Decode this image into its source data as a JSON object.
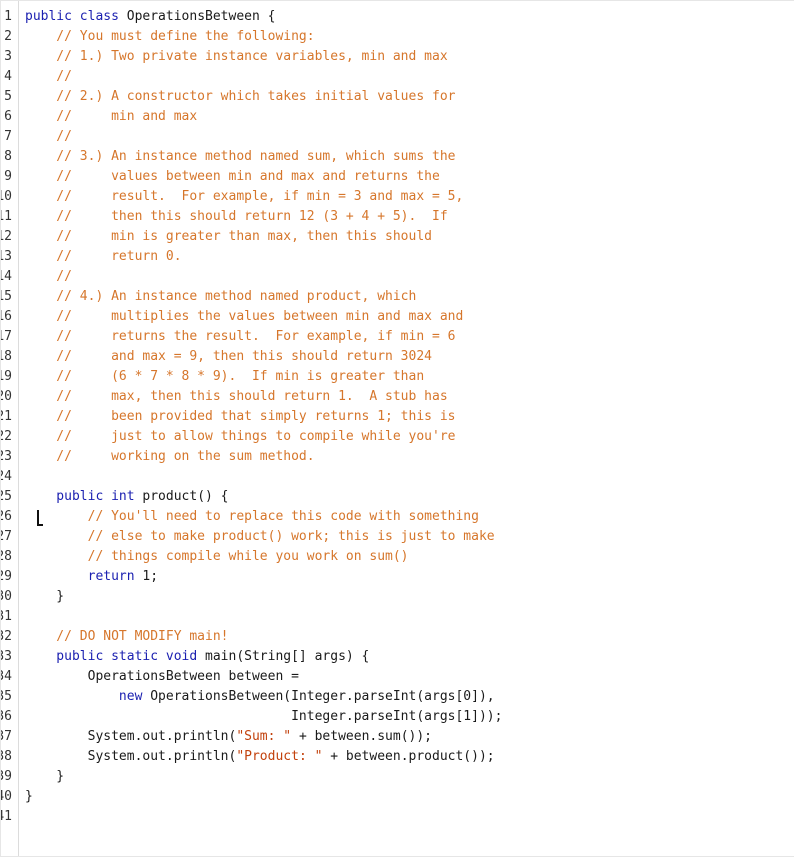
{
  "editor": {
    "language": "Java",
    "lines": [
      {
        "n": "1",
        "segments": [
          {
            "t": "public class ",
            "c": "kw"
          },
          {
            "t": "OperationsBetween {",
            "c": "pl"
          }
        ]
      },
      {
        "n": "2",
        "segments": [
          {
            "t": "    // You must define the following:",
            "c": "cm"
          }
        ]
      },
      {
        "n": "3",
        "segments": [
          {
            "t": "    // 1.) Two private instance variables, min and max",
            "c": "cm"
          }
        ]
      },
      {
        "n": "4",
        "segments": [
          {
            "t": "    //",
            "c": "cm"
          }
        ]
      },
      {
        "n": "5",
        "segments": [
          {
            "t": "    // 2.) A constructor which takes initial values for",
            "c": "cm"
          }
        ]
      },
      {
        "n": "6",
        "segments": [
          {
            "t": "    //     min and max",
            "c": "cm"
          }
        ]
      },
      {
        "n": "7",
        "segments": [
          {
            "t": "    //",
            "c": "cm"
          }
        ]
      },
      {
        "n": "8",
        "segments": [
          {
            "t": "    // 3.) An instance method named sum, which sums the",
            "c": "cm"
          }
        ]
      },
      {
        "n": "9",
        "segments": [
          {
            "t": "    //     values between min and max and returns the",
            "c": "cm"
          }
        ]
      },
      {
        "n": "10",
        "segments": [
          {
            "t": "    //     result.  For example, if min = 3 and max = 5,",
            "c": "cm"
          }
        ]
      },
      {
        "n": "11",
        "segments": [
          {
            "t": "    //     then this should return 12 (3 + 4 + 5).  If",
            "c": "cm"
          }
        ]
      },
      {
        "n": "12",
        "segments": [
          {
            "t": "    //     min is greater than max, then this should",
            "c": "cm"
          }
        ]
      },
      {
        "n": "13",
        "segments": [
          {
            "t": "    //     return 0.",
            "c": "cm"
          }
        ]
      },
      {
        "n": "14",
        "segments": [
          {
            "t": "    //",
            "c": "cm"
          }
        ]
      },
      {
        "n": "15",
        "segments": [
          {
            "t": "    // 4.) An instance method named product, which",
            "c": "cm"
          }
        ]
      },
      {
        "n": "16",
        "segments": [
          {
            "t": "    //     multiplies the values between min and max and",
            "c": "cm"
          }
        ]
      },
      {
        "n": "17",
        "segments": [
          {
            "t": "    //     returns the result.  For example, if min = 6",
            "c": "cm"
          }
        ]
      },
      {
        "n": "18",
        "segments": [
          {
            "t": "    //     and max = 9, then this should return 3024",
            "c": "cm"
          }
        ]
      },
      {
        "n": "19",
        "segments": [
          {
            "t": "    //     (6 * 7 * 8 * 9).  If min is greater than",
            "c": "cm"
          }
        ]
      },
      {
        "n": "20",
        "segments": [
          {
            "t": "    //     max, then this should return 1.  A stub has",
            "c": "cm"
          }
        ]
      },
      {
        "n": "21",
        "segments": [
          {
            "t": "    //     been provided that simply returns 1; this is",
            "c": "cm"
          }
        ]
      },
      {
        "n": "22",
        "segments": [
          {
            "t": "    //     just to allow things to compile while you're",
            "c": "cm"
          }
        ]
      },
      {
        "n": "23",
        "segments": [
          {
            "t": "    //     working on the sum method.",
            "c": "cm"
          }
        ]
      },
      {
        "n": "24",
        "segments": []
      },
      {
        "n": "25",
        "segments": [
          {
            "t": "    public int ",
            "c": "kw"
          },
          {
            "t": "product() {",
            "c": "pl"
          }
        ]
      },
      {
        "n": "26",
        "segments": [
          {
            "t": "        // You'll need to replace this code with something",
            "c": "cm"
          }
        ]
      },
      {
        "n": "27",
        "segments": [
          {
            "t": "        // else to make product() work; this is just to make",
            "c": "cm"
          }
        ]
      },
      {
        "n": "28",
        "segments": [
          {
            "t": "        // things compile while you work on sum()",
            "c": "cm"
          }
        ]
      },
      {
        "n": "29",
        "segments": [
          {
            "t": "        return ",
            "c": "kw"
          },
          {
            "t": "1;",
            "c": "pl"
          }
        ]
      },
      {
        "n": "30",
        "segments": [
          {
            "t": "    }",
            "c": "pl"
          }
        ]
      },
      {
        "n": "31",
        "segments": []
      },
      {
        "n": "32",
        "segments": [
          {
            "t": "    // DO NOT MODIFY main!",
            "c": "cm"
          }
        ]
      },
      {
        "n": "33",
        "segments": [
          {
            "t": "    public static void ",
            "c": "kw"
          },
          {
            "t": "main(String[] args) {",
            "c": "pl"
          }
        ]
      },
      {
        "n": "34",
        "segments": [
          {
            "t": "        OperationsBetween between =",
            "c": "pl"
          }
        ]
      },
      {
        "n": "35",
        "segments": [
          {
            "t": "            new ",
            "c": "kw"
          },
          {
            "t": "OperationsBetween(Integer.parseInt(args[0]),",
            "c": "pl"
          }
        ]
      },
      {
        "n": "36",
        "segments": [
          {
            "t": "                                  Integer.parseInt(args[1]));",
            "c": "pl"
          }
        ]
      },
      {
        "n": "37",
        "segments": [
          {
            "t": "        System.out.println(",
            "c": "pl"
          },
          {
            "t": "\"Sum: \"",
            "c": "str"
          },
          {
            "t": " + between.sum());",
            "c": "pl"
          }
        ]
      },
      {
        "n": "38",
        "segments": [
          {
            "t": "        System.out.println(",
            "c": "pl"
          },
          {
            "t": "\"Product: \"",
            "c": "str"
          },
          {
            "t": " + between.product());",
            "c": "pl"
          }
        ]
      },
      {
        "n": "39",
        "segments": [
          {
            "t": "    }",
            "c": "pl"
          }
        ]
      },
      {
        "n": "40",
        "segments": [
          {
            "t": "}",
            "c": "pl"
          }
        ]
      },
      {
        "n": "41",
        "segments": []
      }
    ]
  }
}
